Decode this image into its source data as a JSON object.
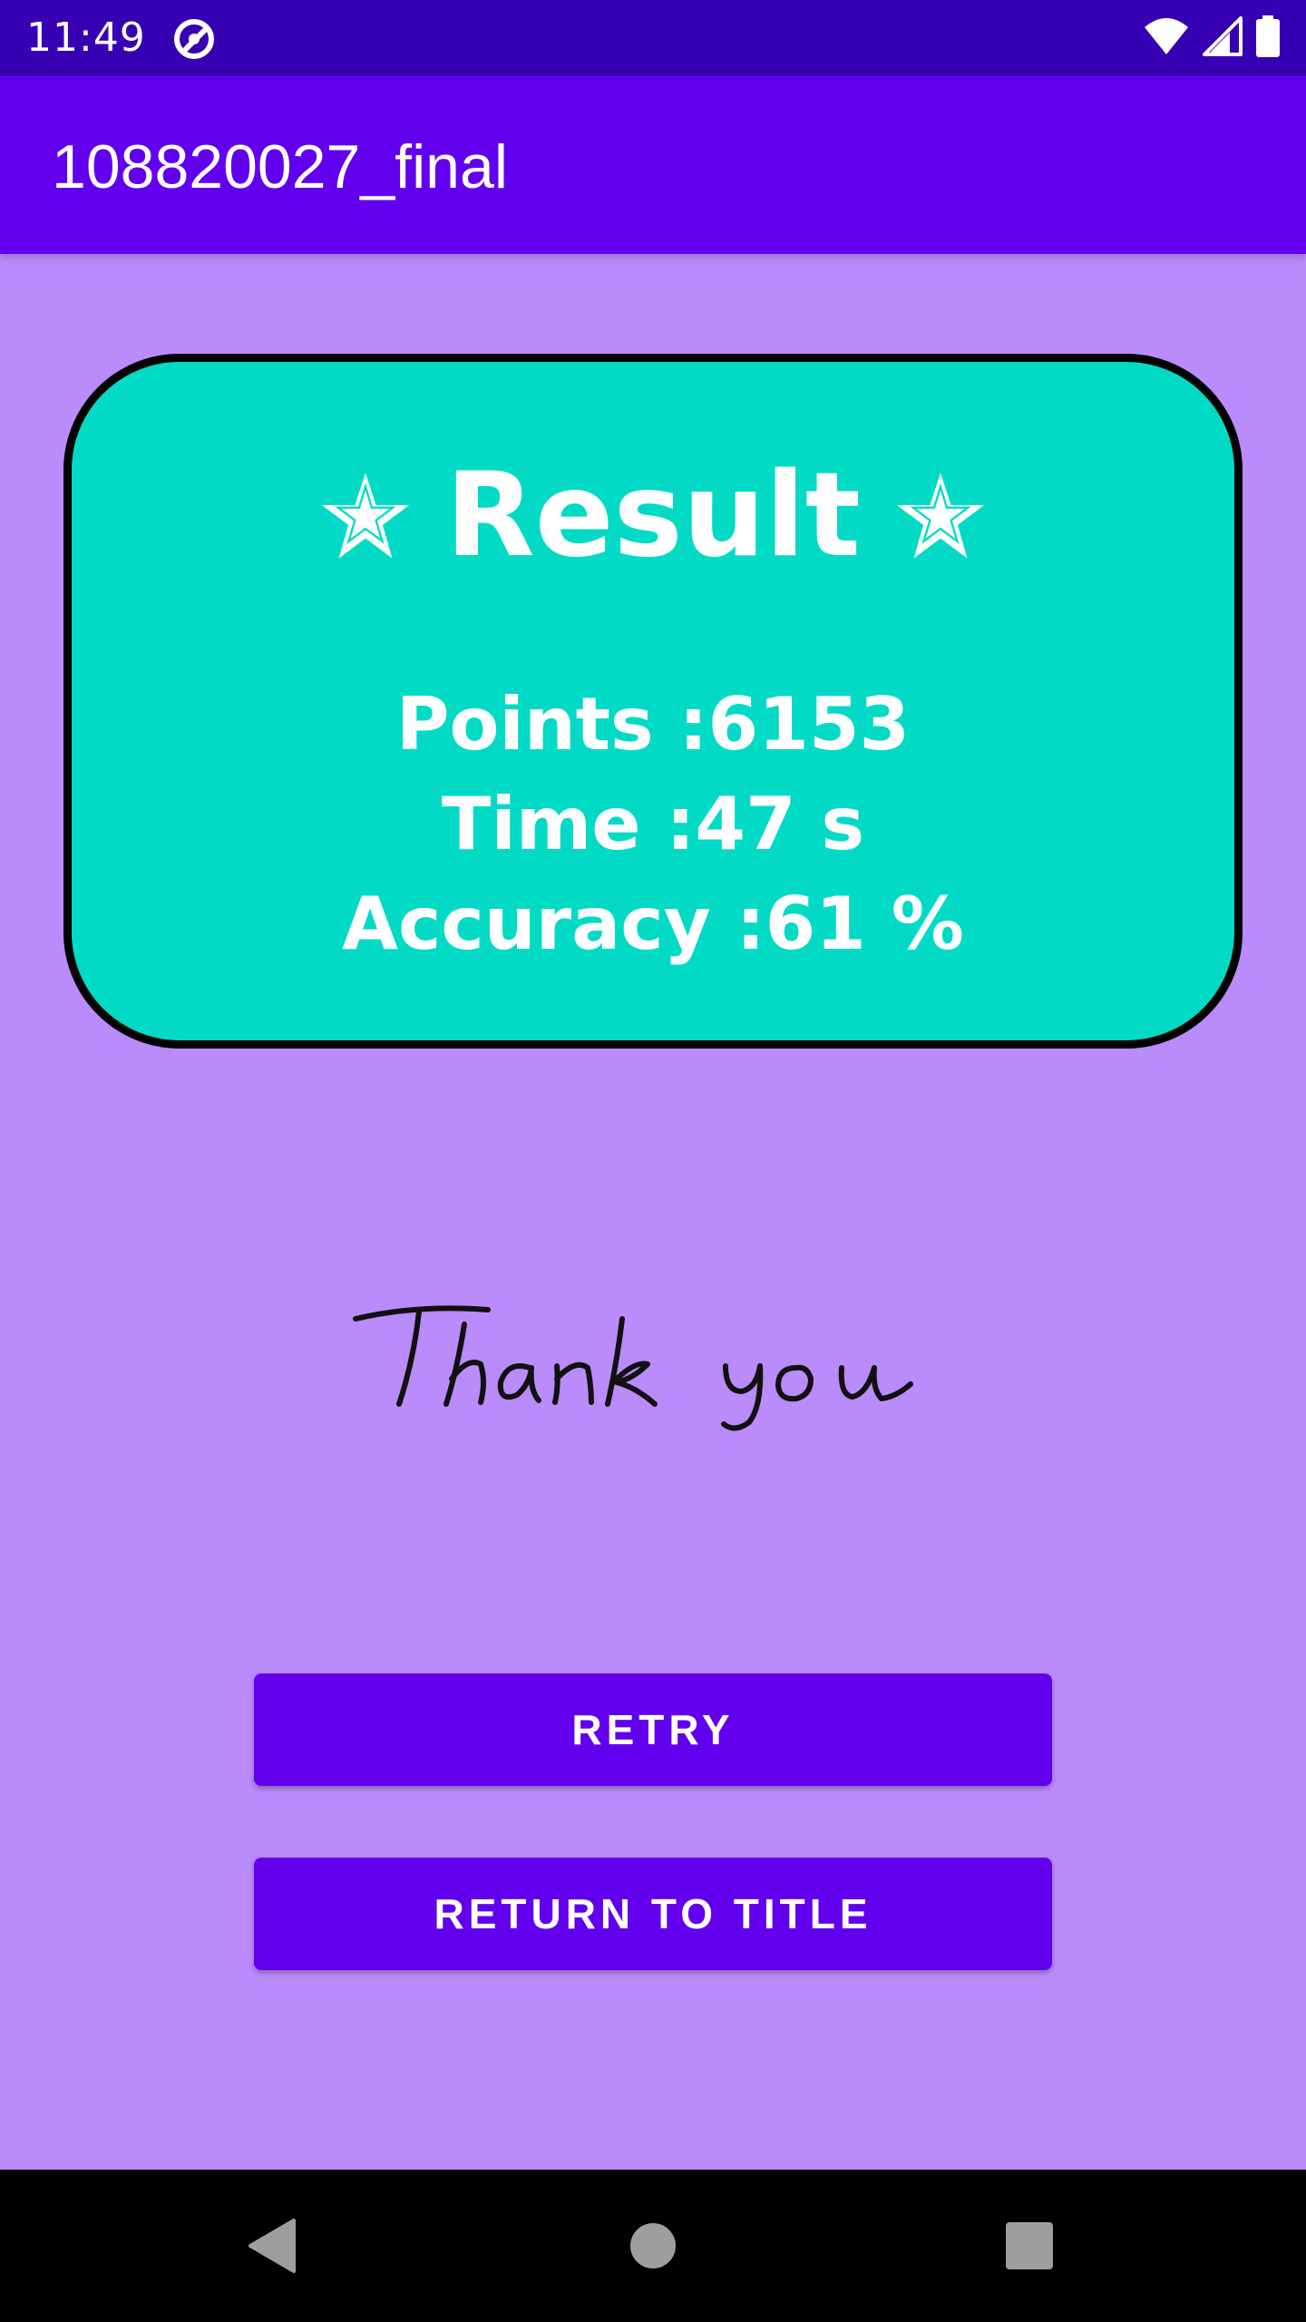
{
  "status_bar": {
    "time": "11:49",
    "icons": [
      "app-notification-icon",
      "wifi-icon",
      "cellular-signal-icon",
      "battery-icon"
    ]
  },
  "app_bar": {
    "title": "108820027_final"
  },
  "result_card": {
    "title": "Result",
    "title_icon": "star-icon",
    "points_label": "Points :6153",
    "time_label": "Time :47 s",
    "accuracy_label": "Accuracy :61 %"
  },
  "thank_you": {
    "text": "Thank you"
  },
  "buttons": {
    "retry_label": "RETRY",
    "return_label": "RETURN TO TITLE"
  },
  "nav_bar": {
    "icons": [
      "back-icon",
      "home-icon",
      "recents-icon"
    ]
  },
  "colors": {
    "status_bar": "#3700b3",
    "app_bar": "#6200ee",
    "background": "#ba8bfb",
    "card": "#03dac5",
    "button": "#6200ee"
  }
}
